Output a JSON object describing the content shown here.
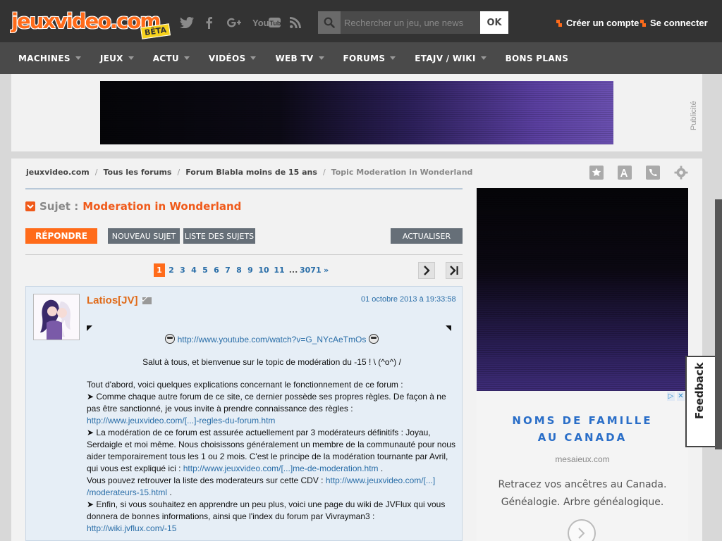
{
  "header": {
    "logo_text": "jeuxvideo.com",
    "logo_badge": "BÊTA",
    "socials": [
      "twitter-icon",
      "facebook-icon",
      "google-plus-icon",
      "youtube-icon",
      "rss-icon"
    ],
    "youtube_label": "YouTube",
    "search_placeholder": "Rechercher un jeu, une news",
    "search_button": "OK",
    "create_account": "Créer un compte",
    "login": "Se connecter"
  },
  "nav": [
    "MACHINES",
    "JEUX",
    "ACTU",
    "VIDÉOS",
    "WEB TV",
    "FORUMS",
    "ETAJV / WIKI",
    "BONS PLANS"
  ],
  "ad": {
    "label": "Publicité"
  },
  "breadcrumb": [
    "jeuxvideo.com",
    "Tous les forums",
    "Forum Blabla moins de 15 ans",
    "Topic Moderation in Wonderland"
  ],
  "topic": {
    "subject_label": "Sujet :",
    "subject_title": "Moderation in Wonderland",
    "reply_button": "RÉPONDRE",
    "new_topic_button": "NOUVEAU SUJET",
    "topic_list_button": "LISTE DES SUJETS",
    "refresh_button": "ACTUALISER"
  },
  "pagination": {
    "pages": [
      "1",
      "2",
      "3",
      "4",
      "5",
      "6",
      "7",
      "8",
      "9",
      "10",
      "11"
    ],
    "ellipsis": "...",
    "last": "3071",
    "more": "»",
    "current": "1"
  },
  "post": {
    "author": "Latios[JV]",
    "date": "01 octobre 2013 à 19:33:58",
    "youtube_link": "http://www.youtube.com/watch?v=G_NYcAeTmOs",
    "greeting": "Salut à tous, et bienvenue sur le topic de modération du -15 ! \\ (^o^) /",
    "intro": "Tout d'abord, voici quelques explications concernant le fonctionnement de ce forum :",
    "p1": "➤ Comme chaque autre forum de ce site, ce dernier possède ses propres règles. De façon à ne pas être sanctionné, je vous invite à prendre connaissance des règles :",
    "p1_link": "http://www.jeuxvideo.com/[...]-regles-du-forum.htm",
    "p2": "➤ La modération de ce forum est assurée actuellement par 3 modérateurs définitifs : Joyau, Serdaigle et moi même. Nous choisissons généralement un membre de la communauté pour nous aider temporairement tous les 1 ou 2 mois. C'est le principe de la modération tournante par Avril, qui vous est expliqué ici :",
    "p2_link": "http://www.jeuxvideo.com/[...]me-de-moderation.htm",
    "p2_end": ".",
    "p3": "Vous pouvez retrouver la liste des moderateurs sur cette CDV :",
    "p3_link_a": "http://www.jeuxvideo.com/[...]",
    "p3_link_b": "/moderateurs-15.html",
    "p3_end": ".",
    "p4": "➤ Enfin, si vous souhaitez en apprendre un peu plus, voici une page du wiki de JVFlux qui vous donnera de bonnes informations, ainsi que l'index du forum par Vivrayman3 :",
    "p4_link": "http://wiki.jvflux.com/-15"
  },
  "sidebar_ad": {
    "headline_1": "NOMS DE FAMILLE",
    "headline_2": "AU CANADA",
    "domain": "mesaieux.com",
    "desc_1": "Retracez vos ancêtres au Canada.",
    "desc_2": "Généalogie. Arbre généalogique."
  },
  "feedback": "Feedback",
  "colors": {
    "accent": "#ff6b1a",
    "link": "#2a6ea8",
    "topbar": "#333333",
    "nav": "#4a4a4a"
  }
}
